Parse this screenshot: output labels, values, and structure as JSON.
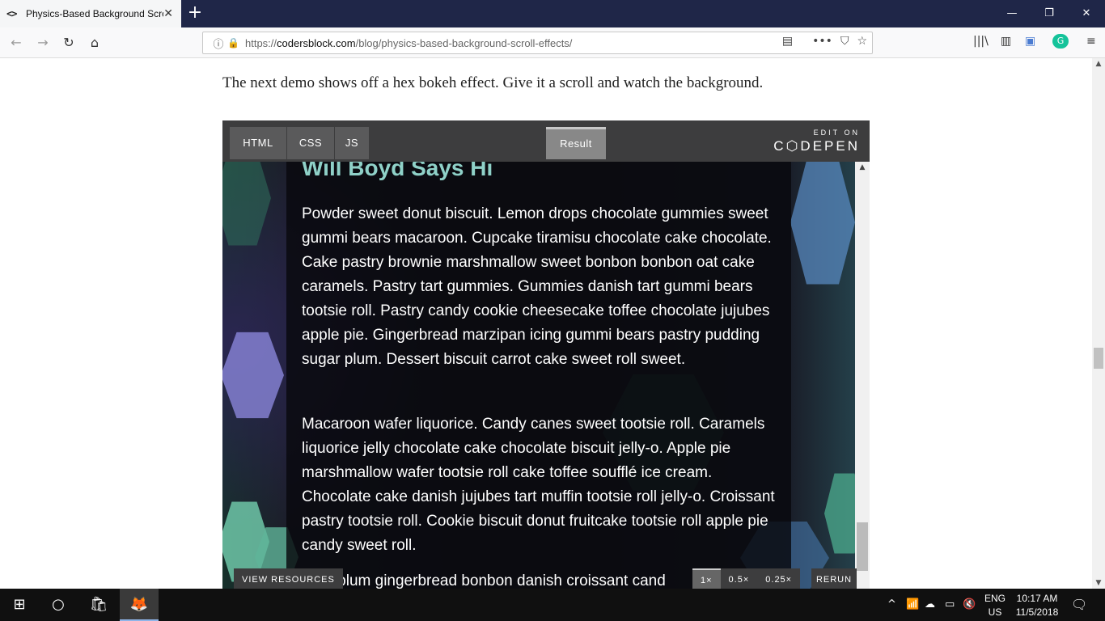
{
  "browser": {
    "tab_title": "Physics-Based Background Scroll E",
    "tab_icon": "<>",
    "tab_close": "✕",
    "new_tab": "+",
    "url_prefix": "https://",
    "url_domain": "codersblock.com",
    "url_path": "/blog/physics-based-background-scroll-effects/"
  },
  "article": {
    "intro": "The next demo shows off a hex bokeh effect. Give it a scroll and watch the background."
  },
  "codepen": {
    "tabs": [
      "HTML",
      "CSS",
      "JS"
    ],
    "result_tab": "Result",
    "edit_on": "EDIT ON",
    "brand": "C⬡DEPEN",
    "heading": "Will Boyd Says Hi",
    "paragraph1": "Powder sweet donut biscuit. Lemon drops chocolate gummies sweet gummi bears macaroon. Cupcake tiramisu chocolate cake chocolate. Cake pastry brownie marshmallow sweet bonbon bonbon oat cake caramels. Pastry tart gummies. Gummies danish tart gummi bears tootsie roll. Pastry candy cookie cheesecake toffee chocolate jujubes apple pie. Gingerbread marzipan icing gummi bears pastry pudding sugar plum. Dessert biscuit carrot cake sweet roll sweet.",
    "paragraph2": "Macaroon wafer liquorice. Candy canes sweet tootsie roll. Caramels liquorice jelly chocolate cake chocolate biscuit jelly-o. Apple pie marshmallow wafer tootsie roll cake toffee soufflé ice cream. Chocolate cake danish jujubes tart muffin tootsie roll jelly-o. Croissant pastry tootsie roll. Cookie biscuit donut fruitcake tootsie roll apple pie candy sweet roll.",
    "paragraph3_partial": "ar plum gingerbread bonbon danish croissant cand",
    "view_resources": "VIEW RESOURCES",
    "zoom_options": [
      "1×",
      "0.5×",
      "0.25×"
    ],
    "zoom_selected": "1×",
    "rerun": "RERUN",
    "colors": {
      "heading": "#8fd1c8",
      "header_bg": "#3d3d3e",
      "hex_teal": "#6fc7a8",
      "hex_purple": "#8a86d9",
      "hex_blue": "#5b8fc8"
    }
  },
  "taskbar": {
    "lang_top": "ENG",
    "lang_bottom": "US",
    "time": "10:17 AM",
    "date": "11/5/2018"
  }
}
